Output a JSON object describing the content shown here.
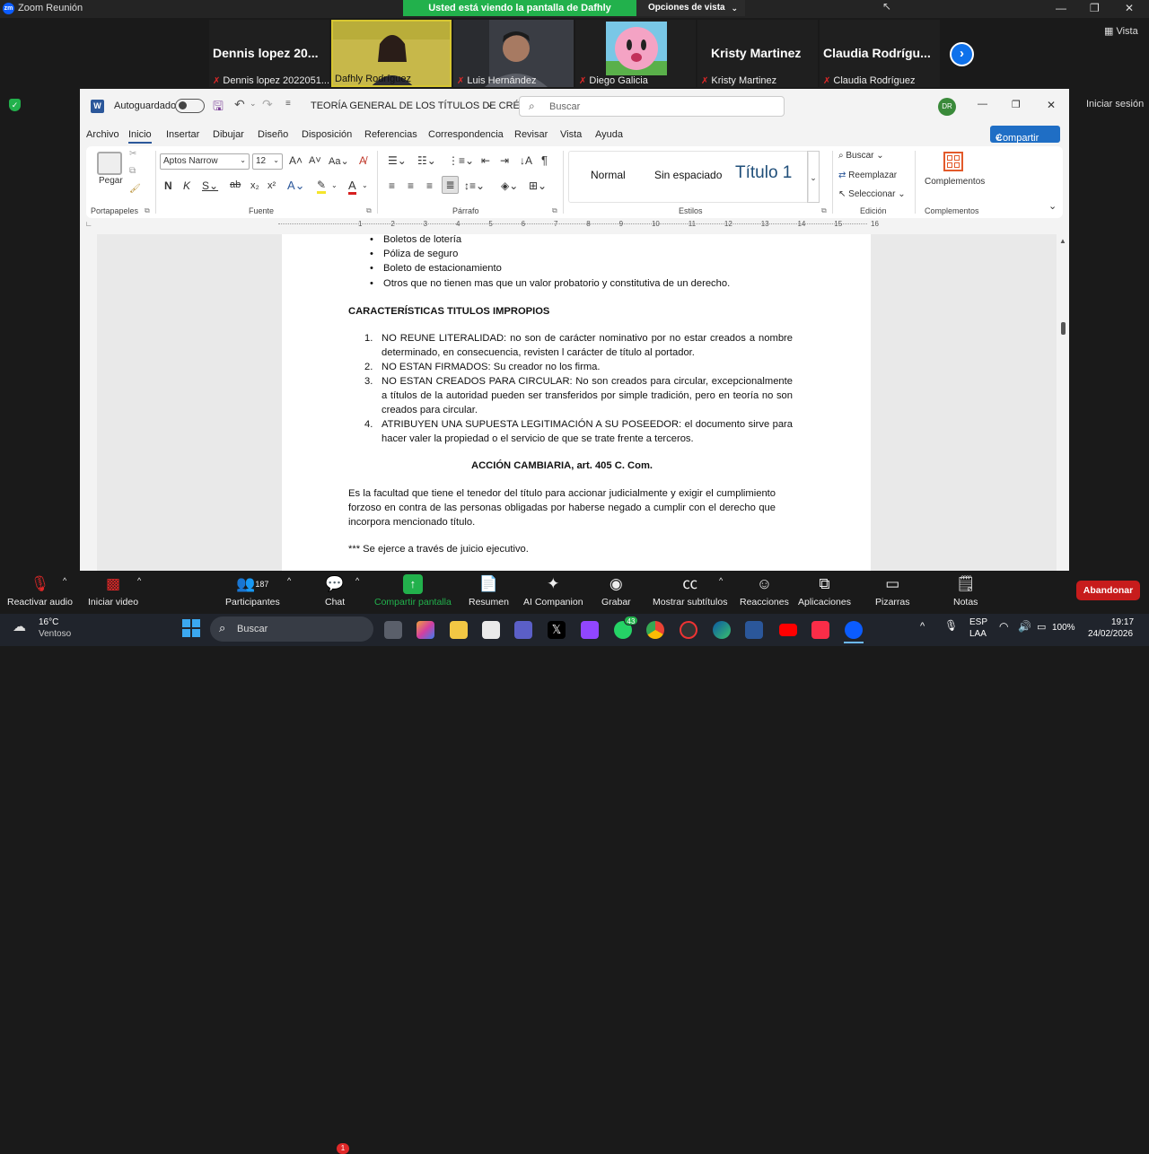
{
  "zoom": {
    "window_title": "Zoom Reunión",
    "share_banner": "Usted está viendo la pantalla de Dafhly Rodríguez",
    "view_options": "Opciones de vista",
    "vista_label": "Vista",
    "iniciar_sesion": "Iniciar sesión",
    "participants": [
      {
        "big": "Dennis lopez 20...",
        "name": "Dennis lopez 2022051..."
      },
      {
        "big": "",
        "name": "Dafhly Rodríguez"
      },
      {
        "big": "",
        "name": "Luis Hernández"
      },
      {
        "big": "",
        "name": "Diego Galicia"
      },
      {
        "big": "Kristy Martinez",
        "name": "Kristy Martinez"
      },
      {
        "big": "Claudia Rodrígu...",
        "name": "Claudia Rodríguez"
      }
    ]
  },
  "word": {
    "autosave": "Autoguardado",
    "doc_title": "TEORÍA GENERAL DE LOS TÍTULOS DE CRÉ...",
    "search_placeholder": "Buscar",
    "avatar": "DR",
    "tabs": [
      "Archivo",
      "Inicio",
      "Insertar",
      "Dibujar",
      "Diseño",
      "Disposición",
      "Referencias",
      "Correspondencia",
      "Revisar",
      "Vista",
      "Ayuda"
    ],
    "share": "Compartir",
    "ribbon": {
      "pegar": "Pegar",
      "portapapeles": "Portapapeles",
      "font_name": "Aptos Narrow",
      "font_size": "12",
      "fuente": "Fuente",
      "parrafo": "Párrafo",
      "estilos": "Estilos",
      "style_normal": "Normal",
      "style_sin": "Sin espaciado",
      "style_titulo": "Título 1",
      "buscar": "Buscar",
      "reemplazar": "Reemplazar",
      "seleccionar": "Seleccionar",
      "edicion": "Edición",
      "complementos": "Complementos",
      "complementos_grp": "Complementos"
    },
    "ruler_numbers": [
      "1",
      "2",
      "3",
      "4",
      "5",
      "6",
      "7",
      "8",
      "9",
      "10",
      "11",
      "12",
      "13",
      "14",
      "15",
      "16"
    ],
    "document": {
      "bullets": [
        "Boletos de lotería",
        "Póliza de seguro",
        "Boleto de estacionamiento",
        "Otros que no tienen mas que un valor probatorio y constitutiva de un derecho."
      ],
      "heading1": "CARACTERÍSTICAS TITULOS IMPROPIOS",
      "items": [
        "NO REUNE LITERALIDAD: no son de carácter nominativo por no estar creados a nombre determinado, en consecuencia, revisten l carácter de título al portador.",
        "NO ESTAN FIRMADOS: Su creador no los firma.",
        "NO ESTAN CREADOS PARA CIRCULAR: No son creados para circular, excepcionalmente a títulos de la autoridad pueden ser transferidos por simple tradición, pero en teoría no son creados para circular.",
        "ATRIBUYEN UNA SUPUESTA LEGITIMACIÓN A SU POSEEDOR: el documento sirve para hacer valer la propiedad o el servicio de que se trate frente a terceros."
      ],
      "heading2": "ACCIÓN CAMBIARIA, art. 405 C. Com.",
      "paragraph": "Es la facultad que tiene el tenedor del título para accionar judicialmente y exigir el cumplimiento forzoso en contra de las personas obligadas por haberse negado a cumplir con el derecho que incorpora mencionado título.",
      "note": "*** Se ejerce a través de juicio ejecutivo."
    }
  },
  "toolbar": {
    "audio": "Reactivar audio",
    "video": "Iniciar video",
    "participants": "Participantes",
    "participant_count": "187",
    "chat": "Chat",
    "chat_badge": "1",
    "share": "Compartir pantalla",
    "resumen": "Resumen",
    "ai": "AI Companion",
    "grabar": "Grabar",
    "subtitulos": "Mostrar subtítulos",
    "reacciones": "Reacciones",
    "aplicaciones": "Aplicaciones",
    "pizarras": "Pizarras",
    "notas": "Notas",
    "abandonar": "Abandonar"
  },
  "taskbar": {
    "temp": "16°C",
    "weather": "Ventoso",
    "search": "Buscar",
    "whatsapp_badge": "43",
    "lang1": "ESP",
    "lang2": "LAA",
    "battery": "100%",
    "time": "19:17",
    "date": "24/02/2026"
  },
  "colors": {
    "share_green": "#22b14c",
    "zoom_blue": "#0e71eb",
    "leave_red": "#c71c1c",
    "word_blue": "#2b579a"
  }
}
